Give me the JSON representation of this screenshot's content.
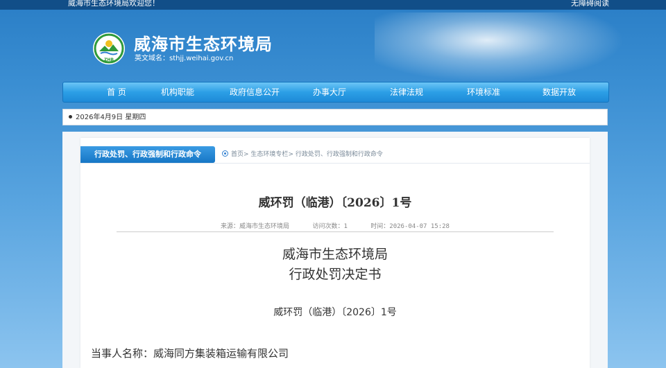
{
  "topbar": {
    "welcome": "威海市生态环境局欢迎您！",
    "accessible": "无障碍阅读"
  },
  "header": {
    "logo_text": "ZHB",
    "title": "威海市生态环境局",
    "domain": "英文域名：sthjj.weihai.gov.cn"
  },
  "nav": {
    "items": [
      {
        "label": "首 页"
      },
      {
        "label": "机构职能"
      },
      {
        "label": "政府信息公开"
      },
      {
        "label": "办事大厅"
      },
      {
        "label": "法律法规"
      },
      {
        "label": "环境标准"
      },
      {
        "label": "数据开放"
      }
    ]
  },
  "datebar": {
    "date": "2026年4月9日 星期四"
  },
  "section": {
    "tab": "行政处罚、行政强制和行政命令",
    "breadcrumb": [
      {
        "label": "首页"
      },
      {
        "label": "生态环境专栏"
      },
      {
        "label": "行政处罚、行政强制和行政命令"
      }
    ],
    "breadcrumb_sep": "> "
  },
  "article": {
    "title": "威环罚（临港）〔2026〕1号",
    "source": "来源：威海市生态环境局",
    "visits": "访问次数：1",
    "time": "时间：2026-04-07 15:28",
    "agency": "威海市生态环境局",
    "doc_type": "行政处罚决定书",
    "doc_number": "威环罚（临港）〔2026〕1号",
    "party": "当事人名称：威海同方集装箱运输有限公司"
  },
  "colors": {
    "brand_blue": "#1676c5",
    "nav_blue": "#2c9fe6",
    "logo_green": "#2f9a3a"
  }
}
